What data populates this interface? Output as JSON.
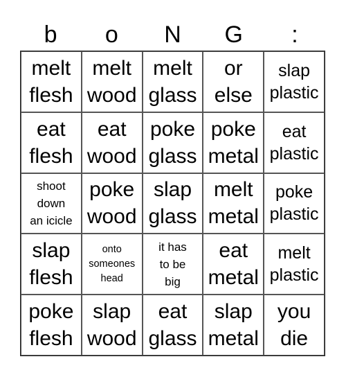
{
  "header": [
    "b",
    "o",
    "N",
    "G",
    ":"
  ],
  "cells": [
    [
      "melt flesh",
      "melt wood",
      "melt glass",
      "or else",
      "slap plastic"
    ],
    [
      "eat flesh",
      "eat wood",
      "poke glass",
      "poke metal",
      "eat plastic"
    ],
    [
      "shoot down an icicle",
      "poke wood",
      "slap glass",
      "melt metal",
      "poke plastic"
    ],
    [
      "slap flesh",
      "onto someones head",
      "it has to be big",
      "eat metal",
      "melt plastic"
    ],
    [
      "poke flesh",
      "slap wood",
      "eat glass",
      "slap metal",
      "you die"
    ]
  ],
  "cell_lines": [
    [
      [
        "melt",
        "flesh"
      ],
      [
        "melt",
        "wood"
      ],
      [
        "melt",
        "glass"
      ],
      [
        "or",
        "else"
      ],
      [
        "slap",
        "plastic"
      ]
    ],
    [
      [
        "eat",
        "flesh"
      ],
      [
        "eat",
        "wood"
      ],
      [
        "poke",
        "glass"
      ],
      [
        "poke",
        "metal"
      ],
      [
        "eat",
        "plastic"
      ]
    ],
    [
      [
        "shoot",
        "down",
        "an icicle"
      ],
      [
        "poke",
        "wood"
      ],
      [
        "slap",
        "glass"
      ],
      [
        "melt",
        "metal"
      ],
      [
        "poke",
        "plastic"
      ]
    ],
    [
      [
        "slap",
        "flesh"
      ],
      [
        "onto",
        "someones",
        "head"
      ],
      [
        "it has",
        "to be",
        "big"
      ],
      [
        "eat",
        "metal"
      ],
      [
        "melt",
        "plastic"
      ]
    ],
    [
      [
        "poke",
        "flesh"
      ],
      [
        "slap",
        "wood"
      ],
      [
        "eat",
        "glass"
      ],
      [
        "slap",
        "metal"
      ],
      [
        "you",
        "die"
      ]
    ]
  ]
}
